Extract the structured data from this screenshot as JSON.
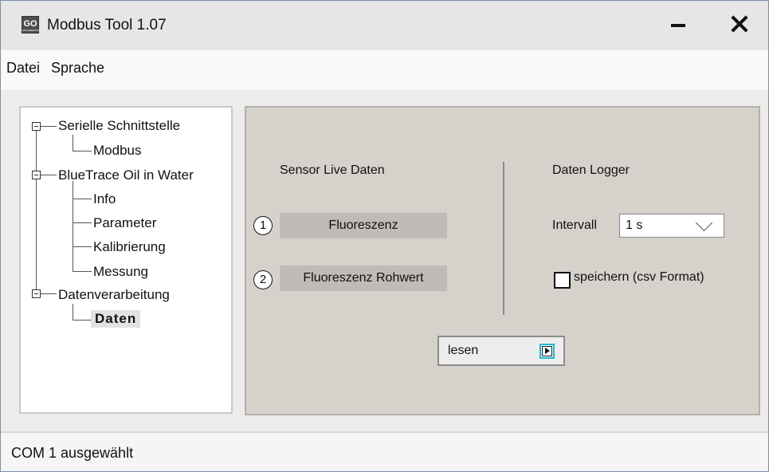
{
  "window": {
    "title": "Modbus Tool 1.07",
    "logo_text": "GO",
    "logo_subtext": "ENGINEERING"
  },
  "menu": {
    "items": [
      "Datei",
      "Sprache"
    ]
  },
  "tree": {
    "items": [
      {
        "label": "Serielle Schnittstelle",
        "level": 0,
        "expanded": true
      },
      {
        "label": "Modbus",
        "level": 1
      },
      {
        "label": "BlueTrace Oil in Water",
        "level": 0,
        "expanded": true
      },
      {
        "label": "Info",
        "level": 1
      },
      {
        "label": "Parameter",
        "level": 1
      },
      {
        "label": "Kalibrierung",
        "level": 1
      },
      {
        "label": "Messung",
        "level": 1
      },
      {
        "label": "Datenverarbeitung",
        "level": 0,
        "expanded": true
      },
      {
        "label": "Daten",
        "level": 1,
        "selected": true
      }
    ]
  },
  "panel": {
    "sensor_heading": "Sensor Live Daten",
    "logger_heading": "Daten Logger",
    "sensor_buttons": [
      {
        "number": "1",
        "label": "Fluoreszenz"
      },
      {
        "number": "2",
        "label": "Fluoreszenz Rohwert"
      }
    ],
    "interval_label": "Intervall",
    "interval_value": "1 s",
    "save_label": "speichern (csv Format)",
    "save_checked": false,
    "read_button": "lesen"
  },
  "status": {
    "text": "COM 1 ausgewählt"
  },
  "colors": {
    "panel_bg": "#d6d1cb",
    "button_bg": "#bebbb8",
    "play_focus": "#1fb6d6"
  }
}
